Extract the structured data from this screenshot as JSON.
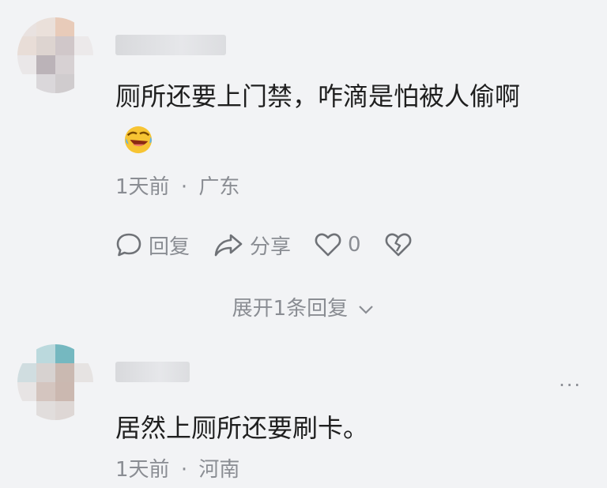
{
  "comments": [
    {
      "text": "厕所还要上门禁，咋滴是怕被人偷啊",
      "emoji": "laughing-crying-emoji",
      "time": "1天前",
      "sep": "·",
      "location": "广东",
      "reply_label": "回复",
      "share_label": "分享",
      "like_count": "0",
      "expand_label": "展开1条回复"
    },
    {
      "text": "居然上厕所还要刷卡。",
      "time": "1天前",
      "sep": "·",
      "location": "河南",
      "more": "···"
    }
  ],
  "colors": {
    "background": "#f2f3f5",
    "meta": "#8a8d93",
    "text": "#1f1f1f"
  }
}
